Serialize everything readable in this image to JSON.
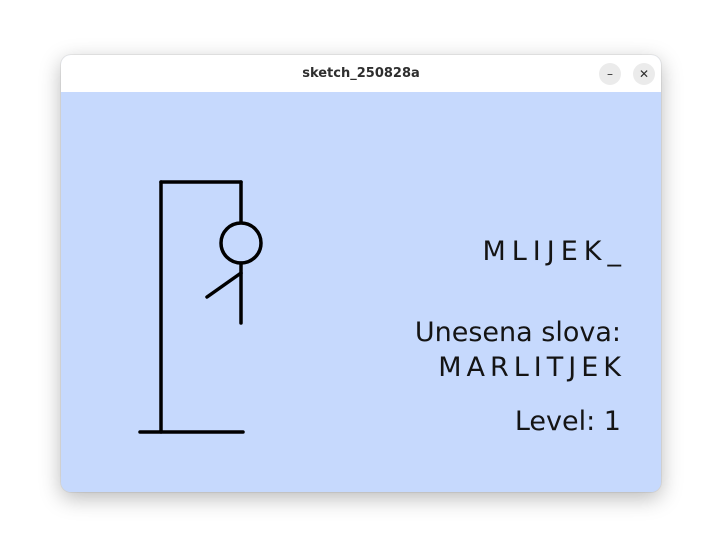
{
  "window": {
    "title": "sketch_250828a",
    "minimize_symbol": "–",
    "close_symbol": "✕"
  },
  "game": {
    "word_display": "MLIJEK_",
    "entered_label": "Unesena slova:",
    "entered_letters": "MARLITJEK",
    "level_label": "Level: 1"
  },
  "colors": {
    "canvas_background": "#c6d9fd",
    "stroke": "#000000",
    "text": "#141414",
    "titlebar": "#ffffff"
  }
}
